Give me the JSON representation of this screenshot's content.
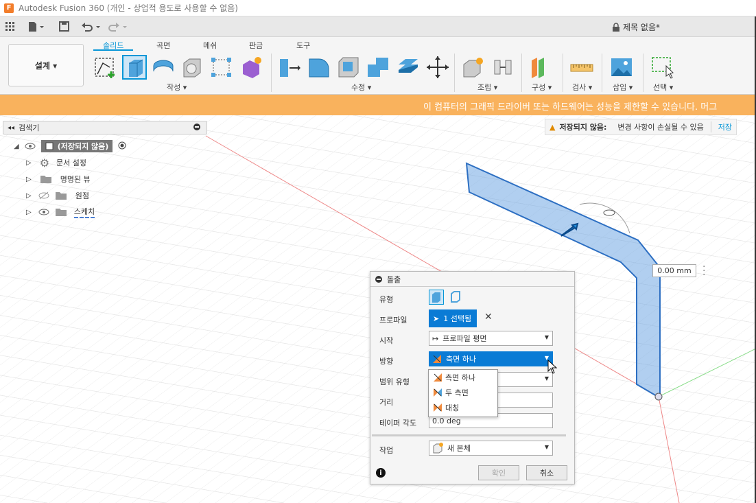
{
  "app": {
    "title": "Autodesk Fusion 360 (개인 - 상업적 용도로 사용할 수 없음)",
    "icon_letter": "F",
    "doc_title": "제목 없음*"
  },
  "ribbon": {
    "workspace": "설계 ▾",
    "tabs": [
      "솔리드",
      "곡면",
      "메쉬",
      "판금",
      "도구"
    ],
    "groups": [
      "작성 ▾",
      "수정 ▾",
      "조립 ▾",
      "구성 ▾",
      "검사 ▾",
      "삽입 ▾",
      "선택 ▾"
    ]
  },
  "warning_bar": "이 컴퓨터의 그래픽 드라이버 또는 하드웨어는 성능을 제한할 수 있습니다. 머그",
  "unsaved": {
    "label": "저장되지 않음:",
    "message": "변경 사항이 손실될 수 있음",
    "action": "저장"
  },
  "browser": {
    "header": "검색기",
    "root": "(저장되지 않음)",
    "items": [
      "문서 설정",
      "명명된 뷰",
      "원점",
      "스케치"
    ]
  },
  "dimension": "0.00 mm",
  "extrude_panel": {
    "title": "돌출",
    "labels": {
      "type": "유형",
      "profile": "프로파일",
      "start": "시작",
      "direction": "방향",
      "extent": "범위 유형",
      "distance": "거리",
      "taper": "테이퍼 각도",
      "operation": "작업"
    },
    "profile_value": "1 선택됨",
    "start_value": "프로파일 평면",
    "direction_value": "측면 하나",
    "taper_value": "0.0 deg",
    "operation_value": "새 본체",
    "ok": "확인",
    "cancel": "취소"
  },
  "direction_dropdown": [
    "측면 하나",
    "두 측면",
    "대칭"
  ],
  "colors": {
    "accent": "#0696d7",
    "warning": "#f9b25d",
    "selection": "#0a7bd5"
  }
}
